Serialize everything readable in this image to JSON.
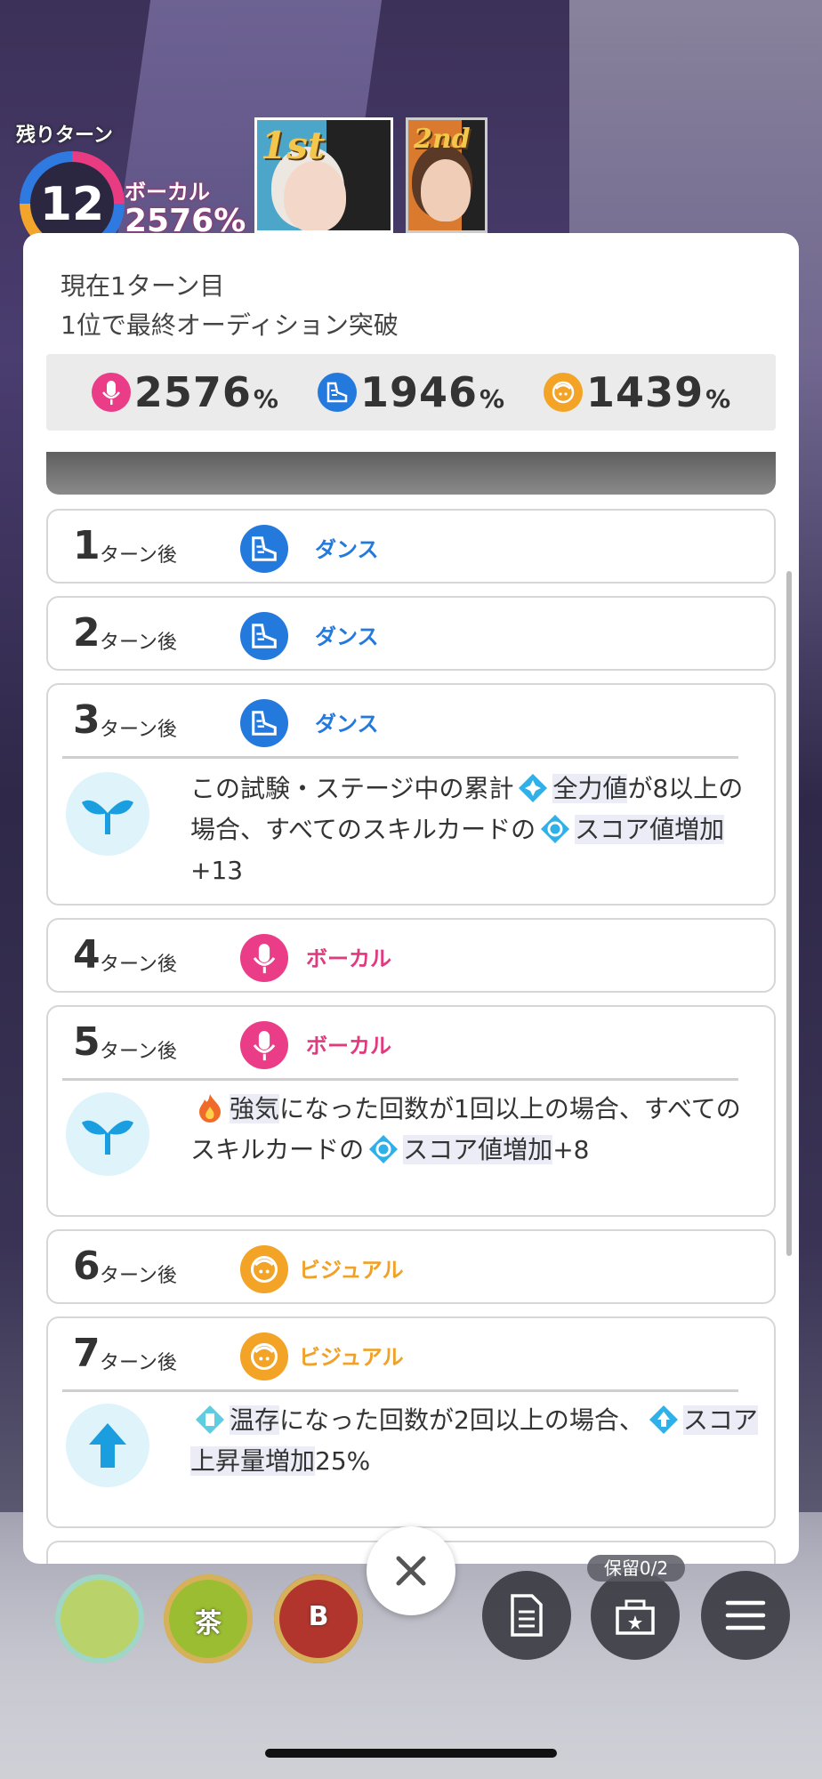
{
  "hud": {
    "turns_label": "残りターン",
    "turns_remaining": "12",
    "lead_stat_label": "ボーカル",
    "lead_stat_value": "2576%",
    "rank_first": "1st",
    "rank_second": "2nd"
  },
  "modal": {
    "status_line1": "現在1ターン目",
    "status_line2": "1位で最終オーディション突破",
    "totals": [
      {
        "type": "vocal",
        "icon": "vocal-mic-icon",
        "value": "2576",
        "unit": "%"
      },
      {
        "type": "dance",
        "icon": "dance-shoe-icon",
        "value": "1946",
        "unit": "%"
      },
      {
        "type": "visual",
        "icon": "visual-face-icon",
        "value": "1439",
        "unit": "%"
      }
    ],
    "turn_suffix": "ターン後",
    "turns": [
      {
        "no": "1",
        "type": "dance",
        "type_label": "ダンス"
      },
      {
        "no": "2",
        "type": "dance",
        "type_label": "ダンス"
      },
      {
        "no": "3",
        "type": "dance",
        "type_label": "ダンス",
        "effect": {
          "icon": "sprout-icon",
          "parts": [
            "この試験・ステージ中の累計",
            "全力値",
            "が8以上の場合、すべてのスキルカードの",
            "スコア値増加",
            "+13"
          ]
        }
      },
      {
        "no": "4",
        "type": "vocal",
        "type_label": "ボーカル"
      },
      {
        "no": "5",
        "type": "vocal",
        "type_label": "ボーカル",
        "effect": {
          "icon": "sprout-icon",
          "parts": [
            "強気",
            "になった回数が1回以上の場合、すべてのスキルカードの",
            "スコア値増加",
            "+8"
          ]
        }
      },
      {
        "no": "6",
        "type": "visual",
        "type_label": "ビジュアル"
      },
      {
        "no": "7",
        "type": "visual",
        "type_label": "ビジュアル",
        "effect": {
          "icon": "arrow-up-icon",
          "parts": [
            "温存",
            "になった回数が2回以上の場合、",
            "スコア上昇量増加",
            "25%"
          ]
        }
      }
    ]
  },
  "bottom": {
    "drinks": [
      {
        "label": "",
        "icon": "drink-bottle-icon"
      },
      {
        "label": "茶",
        "icon": "drink-bottle-icon"
      },
      {
        "label": "B",
        "icon": "drink-bottle-icon"
      }
    ],
    "hold_badge": "保留0/2",
    "buttons": [
      "memo-icon",
      "item-box-icon",
      "menu-icon"
    ]
  },
  "colors": {
    "vocal": "#ea3c87",
    "dance": "#2479dd",
    "visual": "#f3a326",
    "effect_bg": "#dff3fb",
    "effect_icon": "#1a9ee0"
  }
}
